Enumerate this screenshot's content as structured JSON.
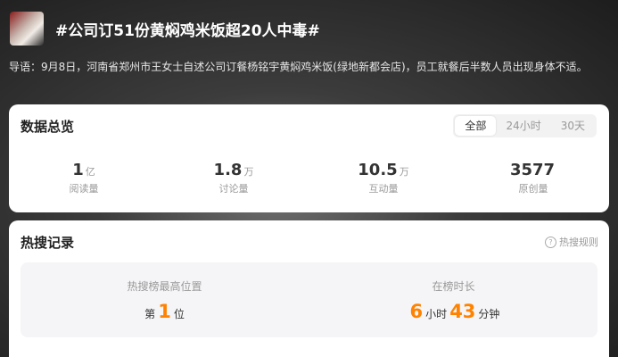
{
  "header": {
    "title": "#公司订51份黄焖鸡米饭超20人中毒#"
  },
  "intro": "导语：9月8日，河南省郑州市王女士自述公司订餐杨铭宇黄焖鸡米饭(绿地新都会店)，员工就餐后半数人员出现身体不适。",
  "overview": {
    "title": "数据总览",
    "tabs": [
      {
        "label": "全部",
        "active": true
      },
      {
        "label": "24小时",
        "active": false
      },
      {
        "label": "30天",
        "active": false
      }
    ],
    "stats": [
      {
        "value": "1",
        "unit": "亿",
        "label": "阅读量"
      },
      {
        "value": "1.8",
        "unit": "万",
        "label": "讨论量"
      },
      {
        "value": "10.5",
        "unit": "万",
        "label": "互动量"
      },
      {
        "value": "3577",
        "unit": "",
        "label": "原创量"
      }
    ]
  },
  "hot": {
    "title": "热搜记录",
    "rules_label": "热搜规则",
    "peak": {
      "label": "热搜榜最高位置",
      "prefix": "第",
      "value": "1",
      "suffix": "位"
    },
    "duration": {
      "label": "在榜时长",
      "hours": "6",
      "hours_unit": "小时",
      "minutes": "43",
      "minutes_unit": "分钟"
    }
  },
  "colors": {
    "accent": "#ff8200",
    "card": "#ffffff",
    "muted": "#999999"
  },
  "icons": [
    "help-circle-icon"
  ]
}
